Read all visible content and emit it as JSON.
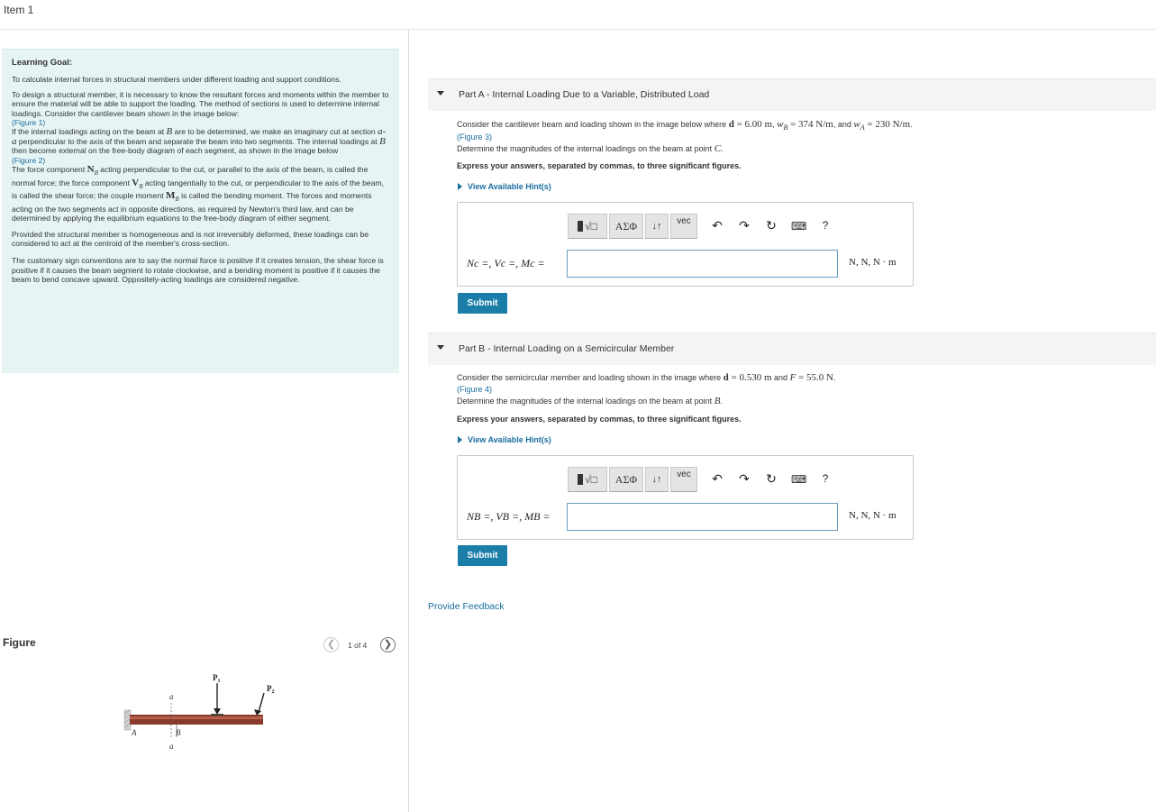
{
  "header": {
    "title": "Item 1"
  },
  "learning_goal": {
    "title": "Learning Goal:",
    "intro": "To calculate internal forces in structural members under different loading and support conditions.",
    "para1": "To design a structural member, it is necessary to know the resultant forces and moments within the member to ensure the material will be able to support the loading. The method of sections is used to determine internal loadings. Consider the cantilever beam shown in the image below:",
    "figure1_link": "(Figure 1)",
    "para2a": "If the internal loadings acting on the beam at ",
    "sym_B": "B",
    "para2b": " are to be determined, we make an imaginary cut at section ",
    "sym_aa": "a-a",
    "para2c": " perpendicular to the axis of the beam and separate the beam into two segments. The internal loadings at ",
    "para2d": " then become external on the free-body diagram of each segment, as shown in the image below",
    "figure2_link": "(Figure 2)",
    "para3a": "The force component ",
    "sym_NB": "N",
    "para3b": " acting perpendicular to the cut, or parallel to the axis of the beam, is called the normal force; the force component ",
    "sym_VB": "V",
    "para3c": " acting tangentially to the cut, or perpendicular to the axis of the beam, is called the shear force; the couple moment ",
    "sym_MB": "M",
    "para3d": " is called the bending moment. The forces and moments acting on the two segments act in opposite directions, as required by Newton's third law, and can be determined by applying the equilibrium equations to the free-body diagram of either segment.",
    "para4": "Provided the structural member is homogeneous and is not irreversibly deformed, these loadings can be considered to act at the centroid of the member's cross-section.",
    "para5": "The customary sign conventions are to say the normal force is positive if it creates tension, the shear force is positive if it causes the beam segment to rotate clockwise, and a bending moment is positive if it causes the beam to bend concave upward. Oppositely-acting loadings are considered negative."
  },
  "figure_panel": {
    "title": "Figure",
    "counter": "1 of 4",
    "prev_icon": "chevron-left-icon",
    "next_icon": "chevron-right-icon",
    "labels": {
      "P1": "P",
      "P1_sub": "1",
      "P2": "P",
      "P2_sub": "2",
      "a_top": "a",
      "a_bottom": "a",
      "A": "A",
      "B": "B"
    }
  },
  "part_a": {
    "title_bold": "Part A",
    "title_rest": " - Internal Loading Due to a Variable, Distributed Load",
    "q1": "Consider the cantilever beam and loading shown in the image below where ",
    "d_sym": "d",
    "d_val": " = 6.00 m",
    "wB_sym": "w",
    "wB_sub": "B",
    "wB_val": " = 374 N/m",
    "wA_sym": "w",
    "wA_sub": "A",
    "wA_val": " = 230 N/m",
    "and": ", and ",
    "comma": ", ",
    "period": ".",
    "figure_link": "(Figure 3)",
    "q2": "Determine the magnitudes of the internal loadings on the beam at point ",
    "point": "C",
    "instruction": "Express your answers, separated by commas, to three significant figures.",
    "hint": "View Available Hint(s)",
    "eq_label": "Nc =, Vc =, Mc =",
    "units": "N, N, N · m",
    "input_value": "",
    "submit": "Submit"
  },
  "part_b": {
    "title_bold": "Part B",
    "title_rest": " - Internal Loading on a Semicircular Member",
    "q1": "Consider the semicircular member and loading shown in the image where ",
    "d_sym": "d",
    "d_val": " = 0.530 m",
    "and": " and ",
    "F_sym": "F",
    "F_val": " = 55.0 N",
    "period": ".",
    "figure_link": "(Figure 4)",
    "q2": "Determine the magnitudes of the internal loadings on the beam at point ",
    "point": "B",
    "instruction": "Express your answers, separated by commas, to three significant figures.",
    "hint": "View Available Hint(s)",
    "eq_label": "NB =, VB =, MB =",
    "units": "N, N, N · m",
    "input_value": "",
    "submit": "Submit"
  },
  "toolbar": {
    "templates": "√□",
    "greek": "ΑΣΦ",
    "arrows": "↓↑",
    "vec": "vec",
    "undo_icon": "undo-icon",
    "redo_icon": "redo-icon",
    "reset_icon": "reset-icon",
    "keyboard_icon": "keyboard-icon",
    "help": "?"
  },
  "feedback": "Provide Feedback"
}
